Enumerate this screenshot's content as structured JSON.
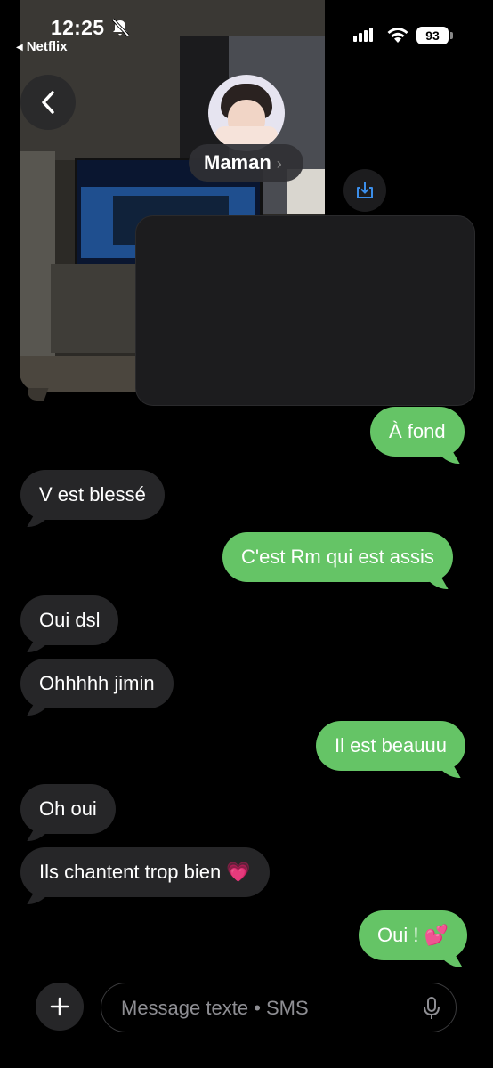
{
  "status_bar": {
    "time": "12:25",
    "back_app": "Netflix",
    "battery": "93"
  },
  "header": {
    "contact_name": "Maman",
    "chevron": "›"
  },
  "messages": [
    {
      "direction": "out",
      "text": "À fond"
    },
    {
      "direction": "in",
      "text": "V est blessé"
    },
    {
      "direction": "out",
      "text": "C'est Rm qui est assis"
    },
    {
      "direction": "in",
      "text": "Oui dsl"
    },
    {
      "direction": "in",
      "text": "Ohhhhh jimin"
    },
    {
      "direction": "out",
      "text": "Il est beauuu"
    },
    {
      "direction": "in",
      "text": "Oh oui"
    },
    {
      "direction": "in",
      "text": "Ils chantent trop bien 💗"
    },
    {
      "direction": "out",
      "text": "Oui ! 💕"
    }
  ],
  "composer": {
    "placeholder": "Message texte • SMS"
  },
  "colors": {
    "outgoing_bubble": "#65c466",
    "incoming_bubble": "#262628",
    "background": "#000000"
  },
  "icons": [
    "bell-slash-icon",
    "signal-icon",
    "wifi-icon",
    "battery-icon",
    "back-chevron-icon",
    "save-to-device-icon",
    "plus-icon",
    "microphone-icon"
  ]
}
